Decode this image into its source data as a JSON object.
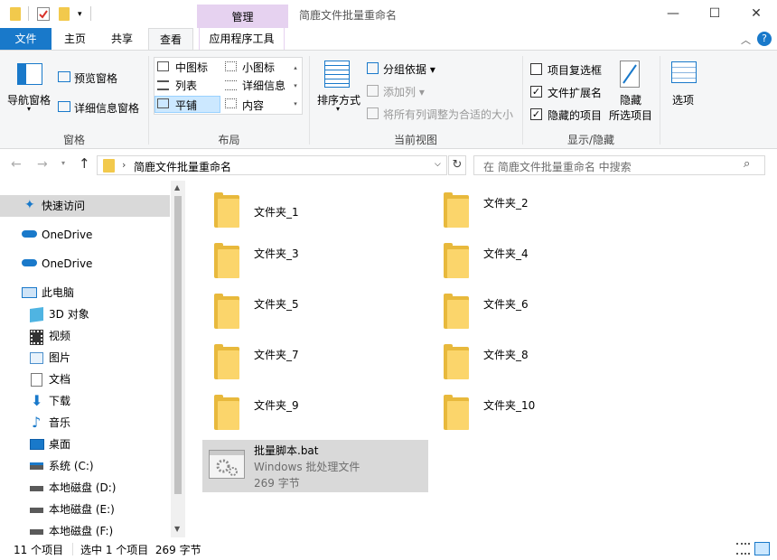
{
  "window": {
    "title": "简鹿文件批量重命名",
    "context_tab": "管理"
  },
  "ribbon_tabs": [
    "文件",
    "主页",
    "共享",
    "查看",
    "应用程序工具"
  ],
  "ribbon": {
    "panes": {
      "nav_pane": "导航窗格",
      "preview_pane": "预览窗格",
      "details_pane": "详细信息窗格",
      "group_label": "窗格"
    },
    "layout": {
      "items": [
        "中图标",
        "小图标",
        "列表",
        "详细信息",
        "平铺",
        "内容"
      ],
      "group_label": "布局"
    },
    "current_view": {
      "sort_by": "排序方式",
      "group_by": "分组依据",
      "add_column": "添加列",
      "fit_columns": "将所有列调整为合适的大小",
      "group_label": "当前视图"
    },
    "show_hide": {
      "item_checkbox": "项目复选框",
      "file_ext": "文件扩展名",
      "hidden_items": "隐藏的项目",
      "hide_selected_1": "隐藏",
      "hide_selected_2": "所选项目",
      "options": "选项",
      "group_label": "显示/隐藏",
      "checked": {
        "item_checkbox": false,
        "file_ext": true,
        "hidden_items": true
      }
    }
  },
  "address": {
    "path": "简鹿文件批量重命名",
    "search_placeholder": "在 简鹿文件批量重命名 中搜索"
  },
  "nav": {
    "quick_access": "快速访问",
    "onedrive1": "OneDrive",
    "onedrive2": "OneDrive",
    "this_pc": "此电脑",
    "items": [
      "3D 对象",
      "视频",
      "图片",
      "文档",
      "下载",
      "音乐",
      "桌面",
      "系统 (C:)",
      "本地磁盘 (D:)",
      "本地磁盘 (E:)",
      "本地磁盘 (F:)"
    ]
  },
  "files": {
    "folders": [
      "文件夹_1",
      "文件夹_2",
      "文件夹_3",
      "文件夹_4",
      "文件夹_5",
      "文件夹_6",
      "文件夹_7",
      "文件夹_8",
      "文件夹_9",
      "文件夹_10"
    ],
    "bat": {
      "name": "批量脚本.bat",
      "type": "Windows 批处理文件",
      "size": "269 字节"
    }
  },
  "status": {
    "count": "11 个项目",
    "selected": "选中 1 个项目  269 字节"
  },
  "colors": {
    "accent": "#1979ca",
    "context_tab_bg": "#e6d2f0",
    "selected_bg": "#cce8ff"
  }
}
